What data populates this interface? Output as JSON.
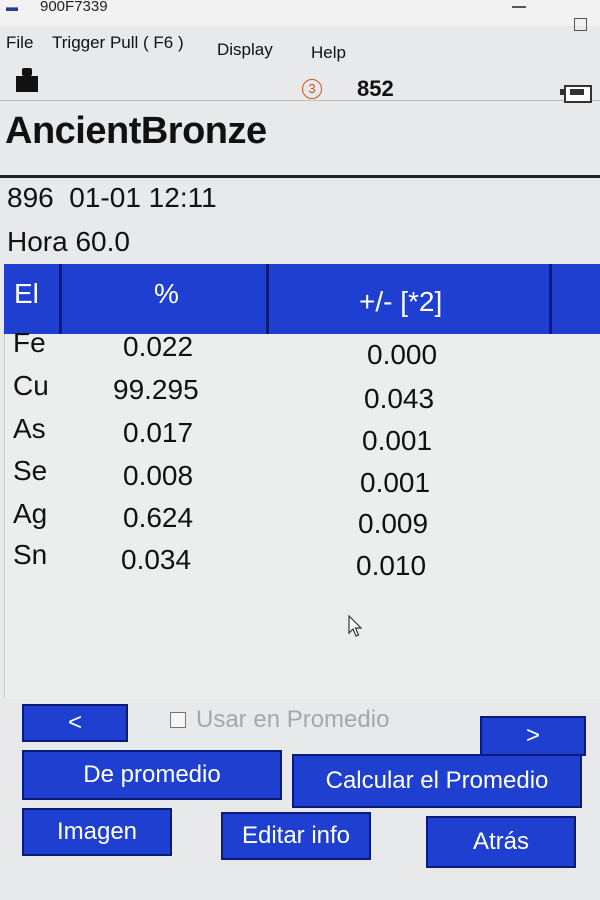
{
  "window": {
    "title": "900F7339"
  },
  "menu": [
    "File",
    "Trigger Pull ( F6 )",
    "Display",
    "Help"
  ],
  "status": {
    "circle_number": "3",
    "count": "852"
  },
  "alloy_name": "AncientBronze",
  "info": {
    "line1": "896  01-01 12:11",
    "line2": "Hora 60.0"
  },
  "table": {
    "headers": [
      "El",
      "%",
      "+/- [*2]"
    ],
    "rows": [
      {
        "el": "Fe",
        "pct": "0.022",
        "err": "0.000"
      },
      {
        "el": "Cu",
        "pct": "99.295",
        "err": "0.043"
      },
      {
        "el": "As",
        "pct": "0.017",
        "err": "0.001"
      },
      {
        "el": "Se",
        "pct": "0.008",
        "err": "0.001"
      },
      {
        "el": "Ag",
        "pct": "0.624",
        "err": "0.009"
      },
      {
        "el": "Sn",
        "pct": "0.034",
        "err": "0.010"
      }
    ]
  },
  "nav": {
    "prev": "<",
    "next": ">",
    "use_in_average": "Usar en Promedio"
  },
  "buttons": {
    "from_average": "De promedio",
    "calculate_average": "Calcular el Promedio",
    "image": "Imagen",
    "edit_info": "Editar info",
    "back": "Atrás"
  },
  "colors": {
    "header_blue": "#1f3fd0",
    "button_blue": "#1f3fd0",
    "accent_orange": "#d2541f"
  },
  "icons": [
    "app-icon",
    "trigger-icon",
    "battery-icon"
  ]
}
